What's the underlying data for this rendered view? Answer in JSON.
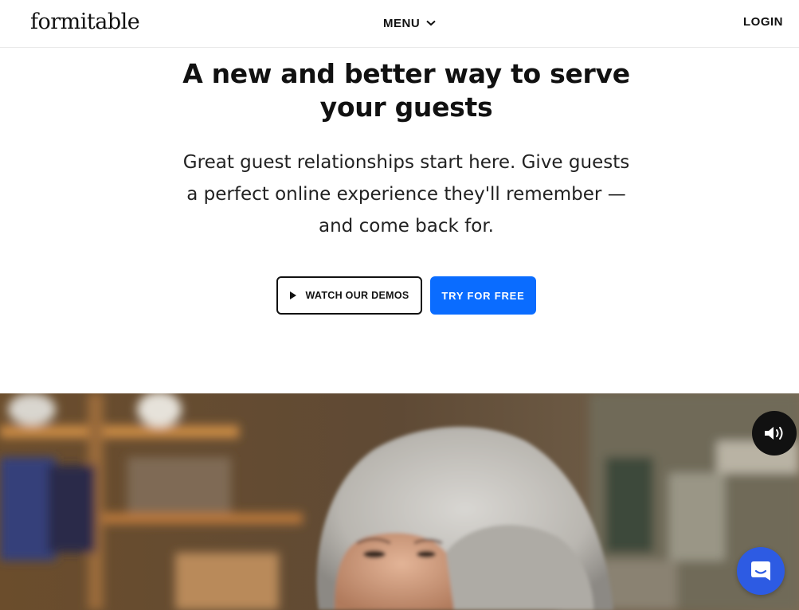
{
  "header": {
    "logo": "formitable",
    "menu_label": "MENU",
    "login_label": "LOGIN"
  },
  "hero": {
    "title_lines": [
      "A new and better way to serve",
      "your guests"
    ],
    "subtitle_lines": [
      "Great guest relationships start here. Give guests",
      "a perfect online experience they'll remember —",
      "and come back for."
    ],
    "watch_label": "WATCH OUR DEMOS",
    "try_label": "TRY FOR FREE"
  },
  "colors": {
    "accent": "#0a6cff",
    "chat": "#2d5be3",
    "text": "#111111"
  },
  "icons": {
    "menu": "chevron-down-icon",
    "watch": "play-icon",
    "sound": "volume-icon",
    "chat": "chat-bubble-icon"
  }
}
